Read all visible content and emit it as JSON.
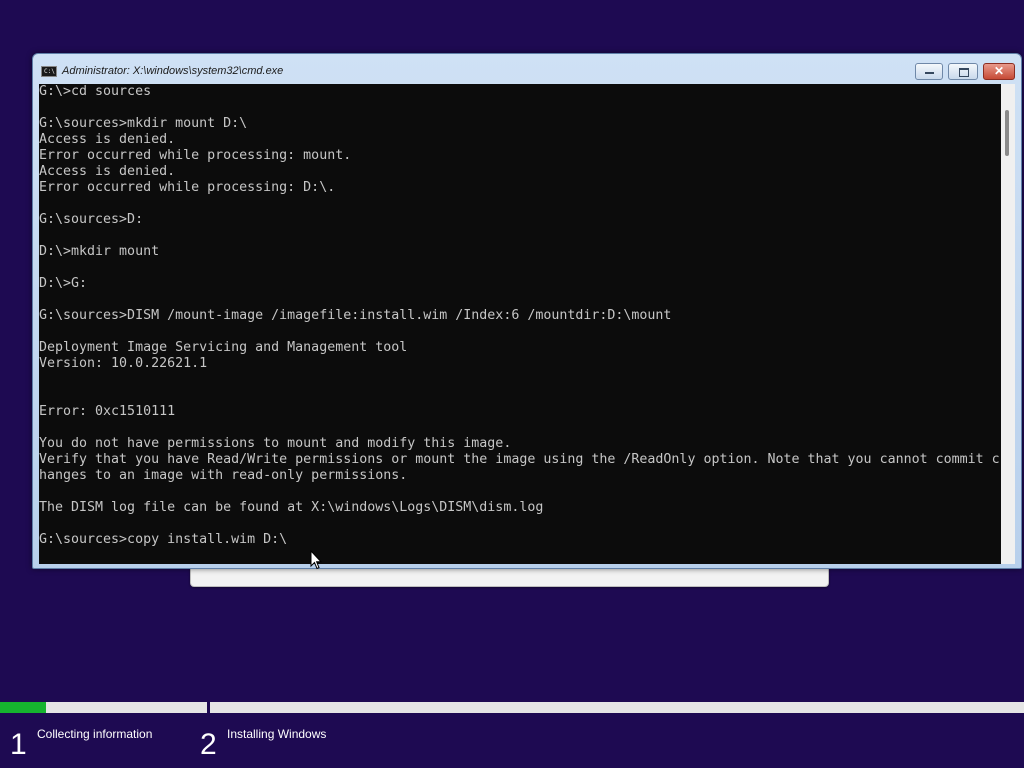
{
  "window": {
    "title": "Administrator: X:\\windows\\system32\\cmd.exe",
    "icon": "cmd-icon",
    "close_glyph": "✕"
  },
  "console": {
    "lines": [
      "G:\\>cd sources",
      "",
      "G:\\sources>mkdir mount D:\\",
      "Access is denied.",
      "Error occurred while processing: mount.",
      "Access is denied.",
      "Error occurred while processing: D:\\.",
      "",
      "G:\\sources>D:",
      "",
      "D:\\>mkdir mount",
      "",
      "D:\\>G:",
      "",
      "G:\\sources>DISM /mount-image /imagefile:install.wim /Index:6 /mountdir:D:\\mount",
      "",
      "Deployment Image Servicing and Management tool",
      "Version: 10.0.22621.1",
      "",
      "",
      "Error: 0xc1510111",
      "",
      "You do not have permissions to mount and modify this image.",
      "Verify that you have Read/Write permissions or mount the image using the /ReadOnly option. Note that you cannot commit c",
      "hanges to an image with read-only permissions.",
      "",
      "The DISM log file can be found at X:\\windows\\Logs\\DISM\\dism.log",
      "",
      "G:\\sources>copy install.wim D:\\"
    ],
    "text_color": "#c6c6c6",
    "background_color": "#0c0c0c"
  },
  "setup": {
    "steps": [
      {
        "number": "1",
        "label": "Collecting information",
        "progress": 0.22
      },
      {
        "number": "2",
        "label": "Installing Windows",
        "progress": 0
      }
    ],
    "progress_color": "#16b32f",
    "background_color": "#1e0a52"
  }
}
